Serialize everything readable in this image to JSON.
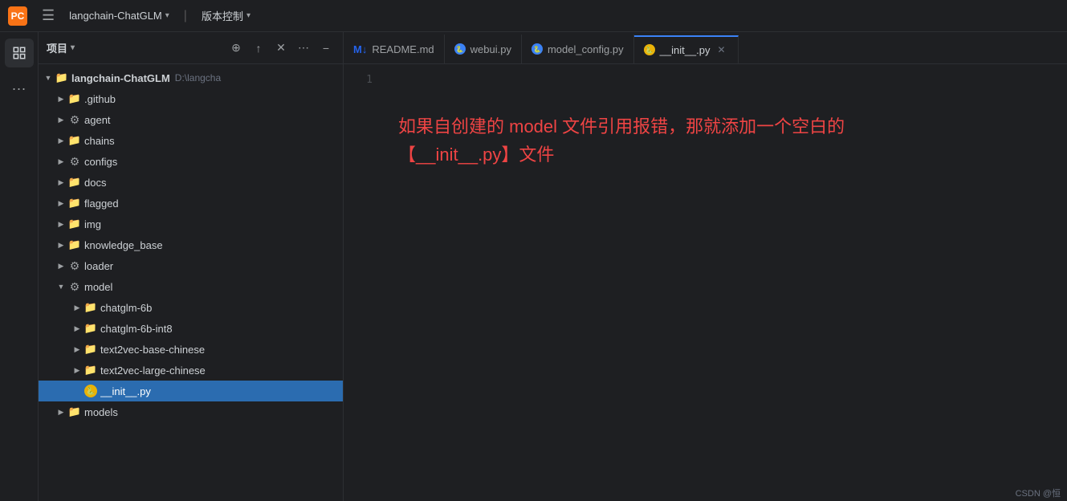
{
  "titlebar": {
    "app_name": "langchain-ChatGLM",
    "version_control": "版本控制",
    "chevron": "▾"
  },
  "tabs": [
    {
      "id": "readme",
      "label": "README.md",
      "icon_type": "md",
      "active": false,
      "closable": false
    },
    {
      "id": "webui",
      "label": "webui.py",
      "icon_type": "py",
      "active": false,
      "closable": false
    },
    {
      "id": "model_config",
      "label": "model_config.py",
      "icon_type": "py",
      "active": false,
      "closable": false
    },
    {
      "id": "init_py",
      "label": "__init__.py",
      "icon_type": "py",
      "active": true,
      "closable": true
    }
  ],
  "sidebar": {
    "title": "项目",
    "actions": [
      "+",
      "⟲",
      "✕",
      "⋯",
      "−"
    ]
  },
  "file_tree": {
    "root": {
      "name": "langchain-ChatGLM",
      "path": "D:\\langcha",
      "expanded": true
    },
    "items": [
      {
        "id": "github",
        "name": ".github",
        "type": "folder",
        "depth": 1,
        "expanded": false,
        "icon": "folder"
      },
      {
        "id": "agent",
        "name": "agent",
        "type": "folder",
        "depth": 1,
        "expanded": false,
        "icon": "gear-folder"
      },
      {
        "id": "chains",
        "name": "chains",
        "type": "folder",
        "depth": 1,
        "expanded": false,
        "icon": "folder"
      },
      {
        "id": "configs",
        "name": "configs",
        "type": "folder",
        "depth": 1,
        "expanded": false,
        "icon": "gear-folder"
      },
      {
        "id": "docs",
        "name": "docs",
        "type": "folder",
        "depth": 1,
        "expanded": false,
        "icon": "folder"
      },
      {
        "id": "flagged",
        "name": "flagged",
        "type": "folder",
        "depth": 1,
        "expanded": false,
        "icon": "folder"
      },
      {
        "id": "img",
        "name": "img",
        "type": "folder",
        "depth": 1,
        "expanded": false,
        "icon": "folder"
      },
      {
        "id": "knowledge_base",
        "name": "knowledge_base",
        "type": "folder",
        "depth": 1,
        "expanded": false,
        "icon": "folder"
      },
      {
        "id": "loader",
        "name": "loader",
        "type": "folder",
        "depth": 1,
        "expanded": false,
        "icon": "gear-folder"
      },
      {
        "id": "model",
        "name": "model",
        "type": "folder",
        "depth": 1,
        "expanded": true,
        "icon": "gear-folder"
      },
      {
        "id": "chatglm-6b",
        "name": "chatglm-6b",
        "type": "folder",
        "depth": 2,
        "expanded": false,
        "icon": "folder"
      },
      {
        "id": "chatglm-6b-int8",
        "name": "chatglm-6b-int8",
        "type": "folder",
        "depth": 2,
        "expanded": false,
        "icon": "folder"
      },
      {
        "id": "text2vec-base-chinese",
        "name": "text2vec-base-chinese",
        "type": "folder",
        "depth": 2,
        "expanded": false,
        "icon": "folder"
      },
      {
        "id": "text2vec-large-chinese",
        "name": "text2vec-large-chinese",
        "type": "folder",
        "depth": 2,
        "expanded": false,
        "icon": "folder"
      },
      {
        "id": "init_py_file",
        "name": "__init__.py",
        "type": "python",
        "depth": 2,
        "expanded": false,
        "icon": "python",
        "selected": true
      },
      {
        "id": "models",
        "name": "models",
        "type": "folder",
        "depth": 1,
        "expanded": false,
        "icon": "folder"
      }
    ]
  },
  "editor": {
    "line_numbers": [
      "1"
    ],
    "annotation_line1": "如果自创建的 model 文件引用报错，那就添加一个空白的",
    "annotation_line2": "【__init__.py】文件"
  },
  "statusbar": {
    "text": "CSDN @恒"
  }
}
